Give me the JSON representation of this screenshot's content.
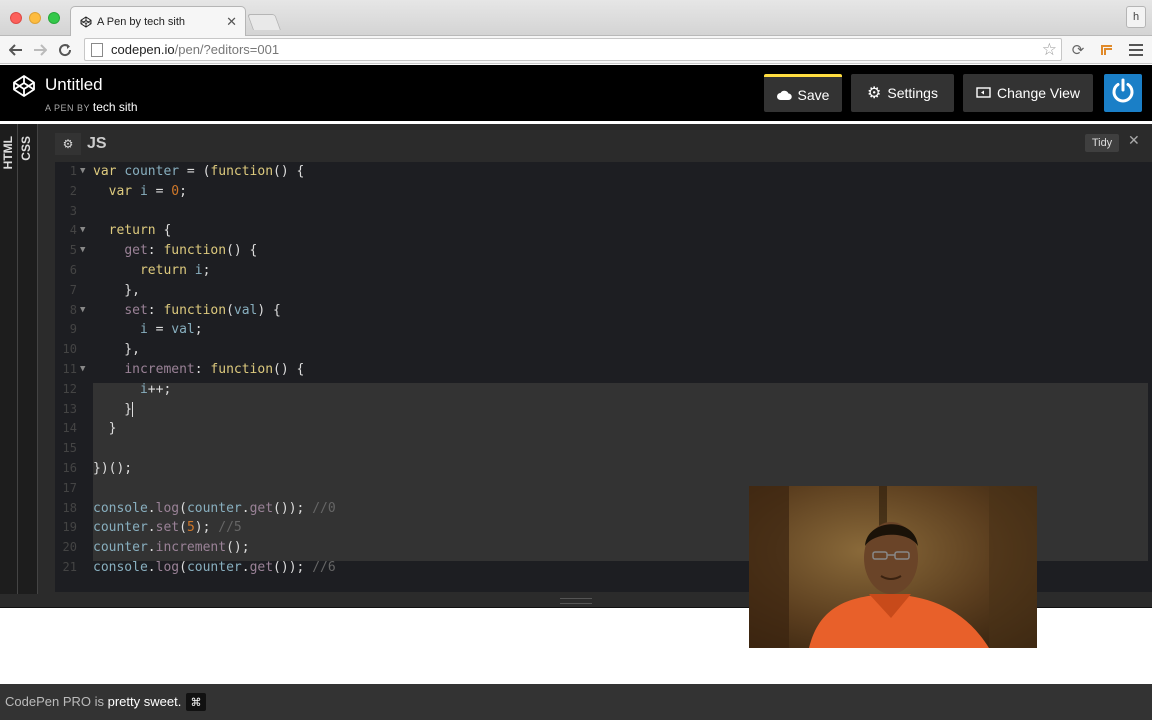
{
  "browser": {
    "tab_title": "A Pen by tech sith",
    "profile_initial": "h",
    "url_host": "codepen.io",
    "url_path": "/pen/?editors=001"
  },
  "header": {
    "title": "Untitled",
    "byline_prefix": "A PEN BY",
    "author": "tech sith",
    "save_label": "Save",
    "settings_label": "Settings",
    "change_view_label": "Change View"
  },
  "sidebar": {
    "html_label": "HTML",
    "css_label": "CSS"
  },
  "editor": {
    "language": "JS",
    "tidy_label": "Tidy",
    "close_label": "✕",
    "line_numbers": [
      "1",
      "2",
      "3",
      "4",
      "5",
      "6",
      "7",
      "8",
      "9",
      "10",
      "11",
      "12",
      "13",
      "14",
      "15",
      "16",
      "17",
      "18",
      "19",
      "20",
      "21"
    ]
  },
  "footer": {
    "text_prefix": "CodePen PRO is",
    "text_bold": "pretty sweet.",
    "cmd_symbol": "⌘"
  },
  "colors": {
    "save_accent": "#ffdd40",
    "user_button": "#1a7fc7",
    "editor_bg": "#1d1e22"
  }
}
